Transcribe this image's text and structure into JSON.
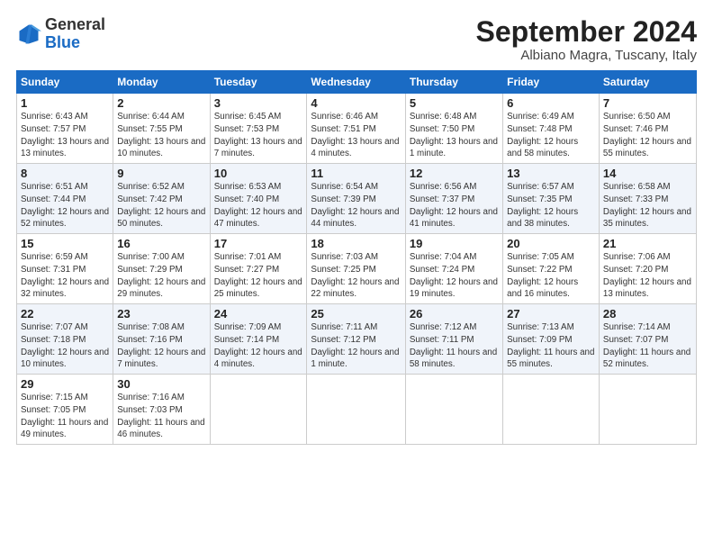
{
  "logo": {
    "general": "General",
    "blue": "Blue"
  },
  "header": {
    "month_year": "September 2024",
    "location": "Albiano Magra, Tuscany, Italy"
  },
  "weekdays": [
    "Sunday",
    "Monday",
    "Tuesday",
    "Wednesday",
    "Thursday",
    "Friday",
    "Saturday"
  ],
  "weeks": [
    [
      {
        "day": "1",
        "sunrise": "6:43 AM",
        "sunset": "7:57 PM",
        "daylight": "13 hours and 13 minutes."
      },
      {
        "day": "2",
        "sunrise": "6:44 AM",
        "sunset": "7:55 PM",
        "daylight": "13 hours and 10 minutes."
      },
      {
        "day": "3",
        "sunrise": "6:45 AM",
        "sunset": "7:53 PM",
        "daylight": "13 hours and 7 minutes."
      },
      {
        "day": "4",
        "sunrise": "6:46 AM",
        "sunset": "7:51 PM",
        "daylight": "13 hours and 4 minutes."
      },
      {
        "day": "5",
        "sunrise": "6:48 AM",
        "sunset": "7:50 PM",
        "daylight": "13 hours and 1 minute."
      },
      {
        "day": "6",
        "sunrise": "6:49 AM",
        "sunset": "7:48 PM",
        "daylight": "12 hours and 58 minutes."
      },
      {
        "day": "7",
        "sunrise": "6:50 AM",
        "sunset": "7:46 PM",
        "daylight": "12 hours and 55 minutes."
      }
    ],
    [
      {
        "day": "8",
        "sunrise": "6:51 AM",
        "sunset": "7:44 PM",
        "daylight": "12 hours and 52 minutes."
      },
      {
        "day": "9",
        "sunrise": "6:52 AM",
        "sunset": "7:42 PM",
        "daylight": "12 hours and 50 minutes."
      },
      {
        "day": "10",
        "sunrise": "6:53 AM",
        "sunset": "7:40 PM",
        "daylight": "12 hours and 47 minutes."
      },
      {
        "day": "11",
        "sunrise": "6:54 AM",
        "sunset": "7:39 PM",
        "daylight": "12 hours and 44 minutes."
      },
      {
        "day": "12",
        "sunrise": "6:56 AM",
        "sunset": "7:37 PM",
        "daylight": "12 hours and 41 minutes."
      },
      {
        "day": "13",
        "sunrise": "6:57 AM",
        "sunset": "7:35 PM",
        "daylight": "12 hours and 38 minutes."
      },
      {
        "day": "14",
        "sunrise": "6:58 AM",
        "sunset": "7:33 PM",
        "daylight": "12 hours and 35 minutes."
      }
    ],
    [
      {
        "day": "15",
        "sunrise": "6:59 AM",
        "sunset": "7:31 PM",
        "daylight": "12 hours and 32 minutes."
      },
      {
        "day": "16",
        "sunrise": "7:00 AM",
        "sunset": "7:29 PM",
        "daylight": "12 hours and 29 minutes."
      },
      {
        "day": "17",
        "sunrise": "7:01 AM",
        "sunset": "7:27 PM",
        "daylight": "12 hours and 25 minutes."
      },
      {
        "day": "18",
        "sunrise": "7:03 AM",
        "sunset": "7:25 PM",
        "daylight": "12 hours and 22 minutes."
      },
      {
        "day": "19",
        "sunrise": "7:04 AM",
        "sunset": "7:24 PM",
        "daylight": "12 hours and 19 minutes."
      },
      {
        "day": "20",
        "sunrise": "7:05 AM",
        "sunset": "7:22 PM",
        "daylight": "12 hours and 16 minutes."
      },
      {
        "day": "21",
        "sunrise": "7:06 AM",
        "sunset": "7:20 PM",
        "daylight": "12 hours and 13 minutes."
      }
    ],
    [
      {
        "day": "22",
        "sunrise": "7:07 AM",
        "sunset": "7:18 PM",
        "daylight": "12 hours and 10 minutes."
      },
      {
        "day": "23",
        "sunrise": "7:08 AM",
        "sunset": "7:16 PM",
        "daylight": "12 hours and 7 minutes."
      },
      {
        "day": "24",
        "sunrise": "7:09 AM",
        "sunset": "7:14 PM",
        "daylight": "12 hours and 4 minutes."
      },
      {
        "day": "25",
        "sunrise": "7:11 AM",
        "sunset": "7:12 PM",
        "daylight": "12 hours and 1 minute."
      },
      {
        "day": "26",
        "sunrise": "7:12 AM",
        "sunset": "7:11 PM",
        "daylight": "11 hours and 58 minutes."
      },
      {
        "day": "27",
        "sunrise": "7:13 AM",
        "sunset": "7:09 PM",
        "daylight": "11 hours and 55 minutes."
      },
      {
        "day": "28",
        "sunrise": "7:14 AM",
        "sunset": "7:07 PM",
        "daylight": "11 hours and 52 minutes."
      }
    ],
    [
      {
        "day": "29",
        "sunrise": "7:15 AM",
        "sunset": "7:05 PM",
        "daylight": "11 hours and 49 minutes."
      },
      {
        "day": "30",
        "sunrise": "7:16 AM",
        "sunset": "7:03 PM",
        "daylight": "11 hours and 46 minutes."
      },
      null,
      null,
      null,
      null,
      null
    ]
  ]
}
